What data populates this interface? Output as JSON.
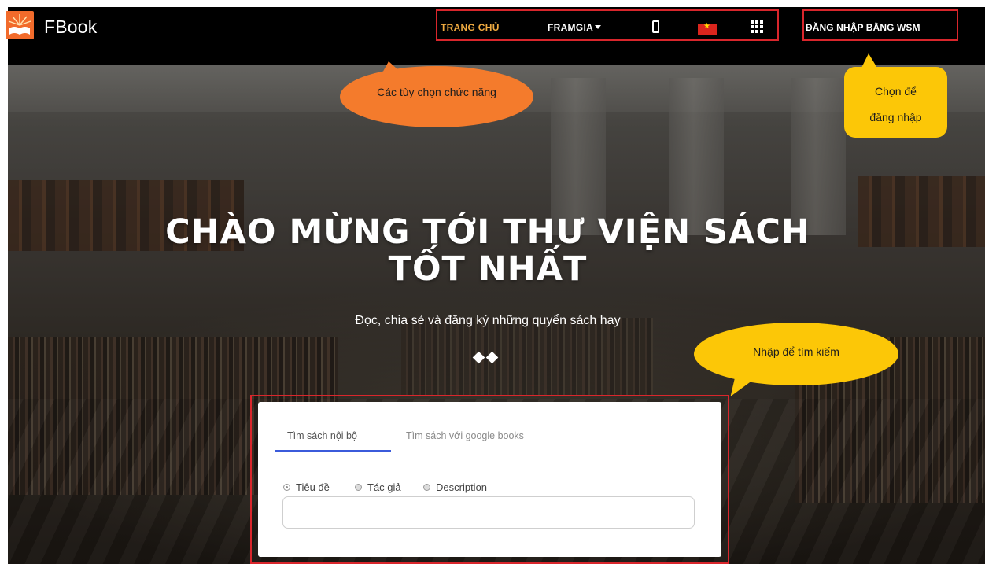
{
  "brand": {
    "name": "FBook",
    "logo_icon": "open-book-sunburst-icon",
    "logo_color": "#f26b2b"
  },
  "nav": {
    "home_label": "TRANG CHỦ",
    "framgia_label": "FRAMGIA",
    "framgia_caret_icon": "caret-down-icon",
    "mobile_icon": "mobile-phone-icon",
    "language_icon": "vietnam-flag-icon",
    "apps_icon": "grid-apps-icon",
    "login_label": "ĐĂNG NHẬP BẰNG WSM",
    "active_color": "#f0ab41",
    "highlight_border_color": "#d9262c"
  },
  "annotations": {
    "functions": "Các tùy chọn chức năng",
    "login_line1": "Chọn để",
    "login_line2": "đăng nhập",
    "search": "Nhập để tìm kiếm",
    "orange_color": "#f47b2c",
    "yellow_color": "#fcc707"
  },
  "hero": {
    "title_line1": "CHÀO MỪNG TỚI THƯ VIỆN SÁCH",
    "title_line2": "TỐT NHẤT",
    "subtitle": "Đọc, chia sẻ và đăng ký những quyển sách hay",
    "divider_icon": "double-diamond-icon"
  },
  "search": {
    "tabs": [
      {
        "label": "Tìm sách nội bộ",
        "active": true
      },
      {
        "label": "Tìm sách với google books",
        "active": false
      }
    ],
    "options": [
      {
        "label": "Tiêu đề",
        "selected": true
      },
      {
        "label": "Tác giả",
        "selected": false
      },
      {
        "label": "Description",
        "selected": false
      }
    ],
    "input_value": "",
    "tab_accent_color": "#3b5bdb"
  }
}
